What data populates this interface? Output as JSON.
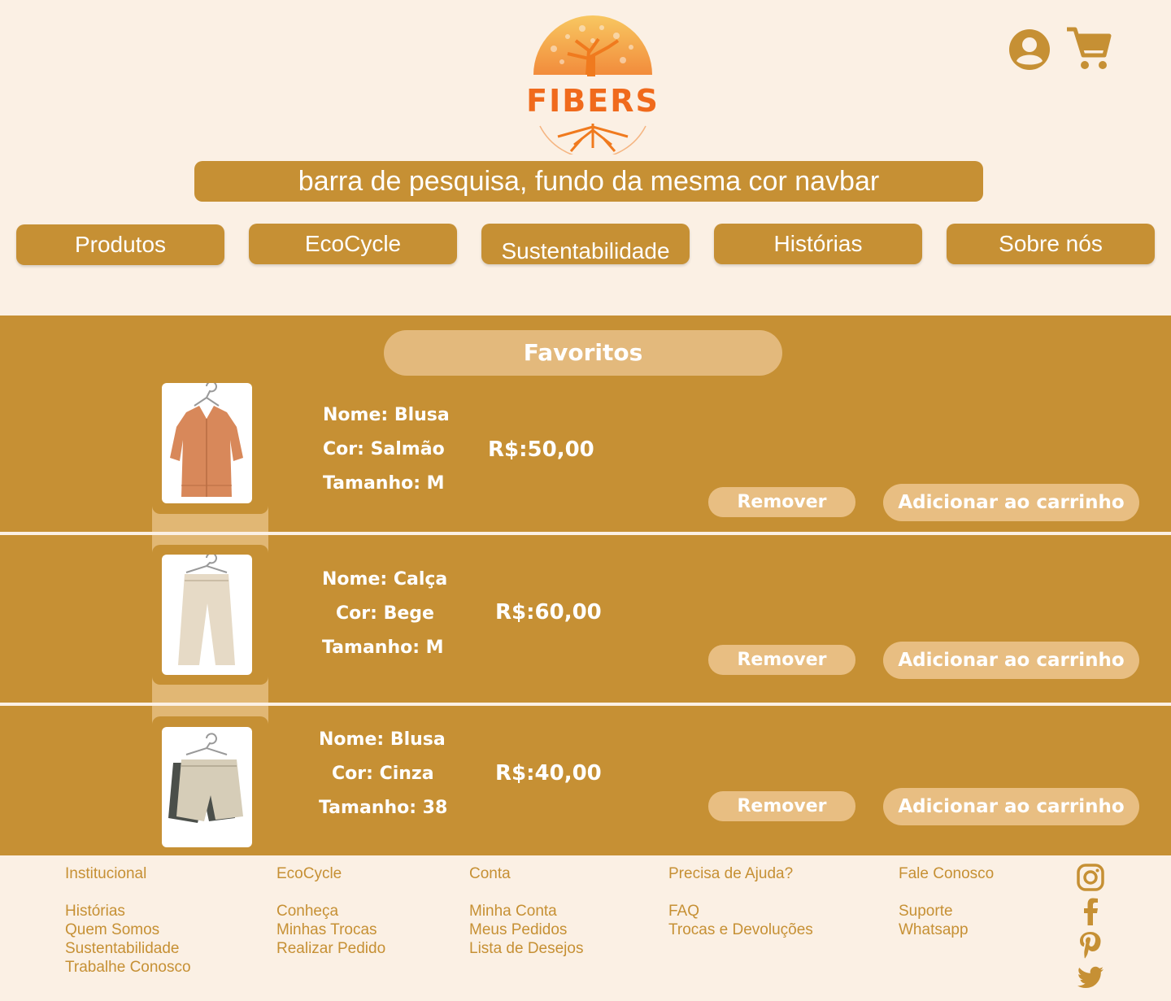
{
  "brand": {
    "name": "FIBERS"
  },
  "header": {
    "search_text": "barra de pesquisa, fundo da mesma cor navbar"
  },
  "nav": [
    "Produtos",
    "EcoCycle",
    "Sustentabilidade",
    "Histórias",
    "Sobre nós"
  ],
  "favorites": {
    "title": "Favoritos",
    "items": [
      {
        "name": "Nome: Blusa",
        "color": "Cor: Salmão",
        "size": "Tamanho: M",
        "price": "R$:50,00",
        "remove": "Remover",
        "add": "Adicionar ao carrinho"
      },
      {
        "name": "Nome: Calça",
        "color": "Cor: Bege",
        "size": "Tamanho: M",
        "price": "R$:60,00",
        "remove": "Remover",
        "add": "Adicionar ao carrinho"
      },
      {
        "name": "Nome: Blusa",
        "color": "Cor: Cinza",
        "size": "Tamanho: 38",
        "price": "R$:40,00",
        "remove": "Remover",
        "add": "Adicionar ao carrinho"
      }
    ]
  },
  "footer": {
    "columns": [
      {
        "head": "Institucional",
        "links": [
          "Histórias",
          "Quem Somos",
          "Sustentabilidade",
          "Trabalhe Conosco"
        ]
      },
      {
        "head": "EcoCycle",
        "links": [
          "Conheça",
          "Minhas Trocas",
          "Realizar Pedido"
        ]
      },
      {
        "head": "Conta",
        "links": [
          "Minha Conta",
          "Meus Pedidos",
          "Lista de Desejos"
        ]
      },
      {
        "head": "Precisa de Ajuda?",
        "links": [
          "FAQ",
          "Trocas e Devoluções"
        ]
      },
      {
        "head": "Fale Conosco",
        "links": [
          "Suporte",
          "Whatsapp"
        ]
      }
    ],
    "social_icons": [
      "instagram-icon",
      "facebook-icon",
      "pinterest-icon",
      "twitter-icon"
    ]
  },
  "colors": {
    "primary": "#c69034",
    "background": "#fbf0e4",
    "light": "#e8be82",
    "logo_orange": "#f06a1c"
  }
}
